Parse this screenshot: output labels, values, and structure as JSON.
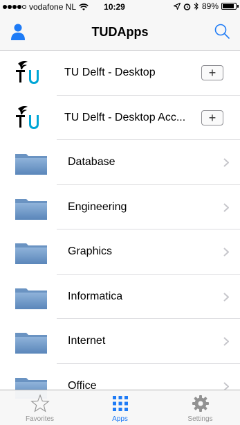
{
  "status": {
    "carrier": "vodafone NL",
    "time": "10:29",
    "battery": "89%",
    "battery_level": 0.89
  },
  "nav": {
    "title": "TUDApps",
    "left_icon": "person-icon",
    "right_icon": "search-icon"
  },
  "apps": [
    {
      "label": "TU Delft - Desktop",
      "action": "+"
    },
    {
      "label": "TU Delft - Desktop Acc...",
      "action": "+"
    }
  ],
  "categories": [
    {
      "label": "Database"
    },
    {
      "label": "Engineering"
    },
    {
      "label": "Graphics"
    },
    {
      "label": "Informatica"
    },
    {
      "label": "Internet"
    },
    {
      "label": "Office"
    }
  ],
  "tabs": [
    {
      "label": "Favorites",
      "icon": "star-icon",
      "active": false
    },
    {
      "label": "Apps",
      "icon": "grid-icon",
      "active": true
    },
    {
      "label": "Settings",
      "icon": "gear-icon",
      "active": false
    }
  ],
  "colors": {
    "accent": "#1e7bf6",
    "tab_inactive": "#929292",
    "folder": "#6a93c2"
  }
}
